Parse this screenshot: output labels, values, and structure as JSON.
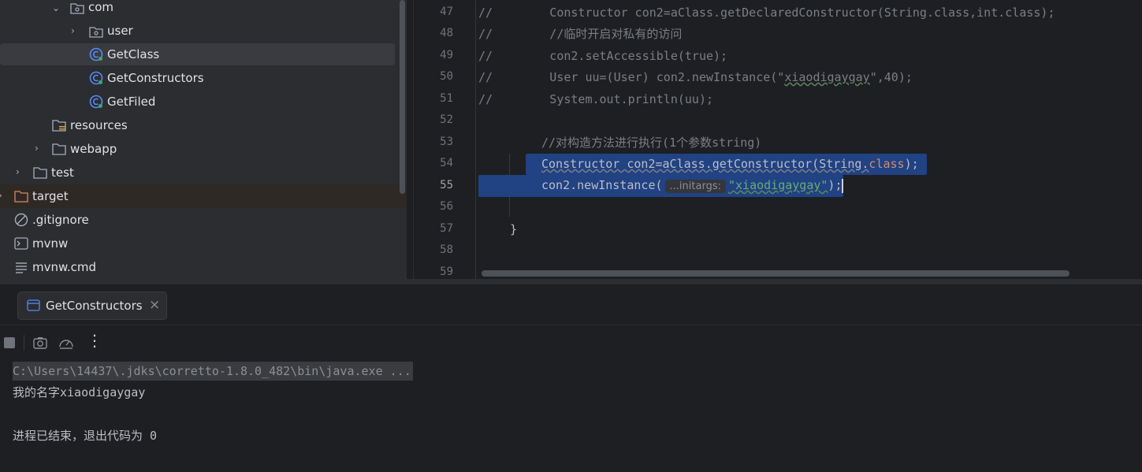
{
  "project_tree": {
    "items": [
      {
        "label": "com",
        "type": "package",
        "expanded": true
      },
      {
        "label": "user",
        "type": "package",
        "expanded": false
      },
      {
        "label": "GetClass",
        "type": "java-class",
        "selected": true
      },
      {
        "label": "GetConstructors",
        "type": "java-class"
      },
      {
        "label": "GetFiled",
        "type": "java-class"
      },
      {
        "label": "resources",
        "type": "resources-folder"
      },
      {
        "label": "webapp",
        "type": "folder",
        "expanded": false
      },
      {
        "label": "test",
        "type": "folder",
        "expanded": false
      },
      {
        "label": "target",
        "type": "excluded-folder",
        "expanded": false
      },
      {
        "label": ".gitignore",
        "type": "ignore-file"
      },
      {
        "label": "mvnw",
        "type": "script-file"
      },
      {
        "label": "mvnw.cmd",
        "type": "text-file"
      }
    ]
  },
  "editor": {
    "current_line": "55",
    "lines": [
      {
        "num": "47",
        "comment_prefix": "//",
        "text": "        Constructor con2=aClass.getDeclaredConstructor(String.class,int.class);"
      },
      {
        "num": "48",
        "comment_prefix": "//",
        "text": "        //临时开启对私有的访问"
      },
      {
        "num": "49",
        "comment_prefix": "//",
        "text": "        con2.setAccessible(true);"
      },
      {
        "num": "50",
        "comment_prefix": "//",
        "text_a": "        User uu=(User) con2.newInstance(\"",
        "text_str": "xiaodigaygay",
        "text_b": "\",40);"
      },
      {
        "num": "51",
        "comment_prefix": "//",
        "text": "        System.out.println(uu);"
      },
      {
        "num": "52"
      },
      {
        "num": "53",
        "comment": "//对构造方法进行执行(1个参数string)"
      },
      {
        "num": "54",
        "code_a": "Constructor con2=aClass.getConstructor(String.",
        "code_kw": "class",
        "code_b": ");"
      },
      {
        "num": "55",
        "code_a": "con2.newInstance(",
        "hint": "...initargs:",
        "code_str": "\"xiaodigaygay\"",
        "code_b": ");"
      },
      {
        "num": "56"
      },
      {
        "num": "57",
        "code": "}"
      },
      {
        "num": "58"
      },
      {
        "num": "59"
      }
    ]
  },
  "run_panel": {
    "tab_label": "GetConstructors",
    "toolbar": [
      "stop-icon",
      "camera-icon",
      "profiler-icon",
      "more-icon"
    ],
    "console": [
      "C:\\Users\\14437\\.jdks\\corretto-1.8.0_482\\bin\\java.exe ...",
      "我的名字xiaodigaygay",
      "",
      "进程已结束，退出代码为 0"
    ]
  },
  "colors": {
    "background": "#1e1f22",
    "panel": "#2b2d30",
    "selection": "#214283",
    "comment": "#7a7e85",
    "keyword": "#cf8e6d",
    "string": "#6aab73"
  }
}
